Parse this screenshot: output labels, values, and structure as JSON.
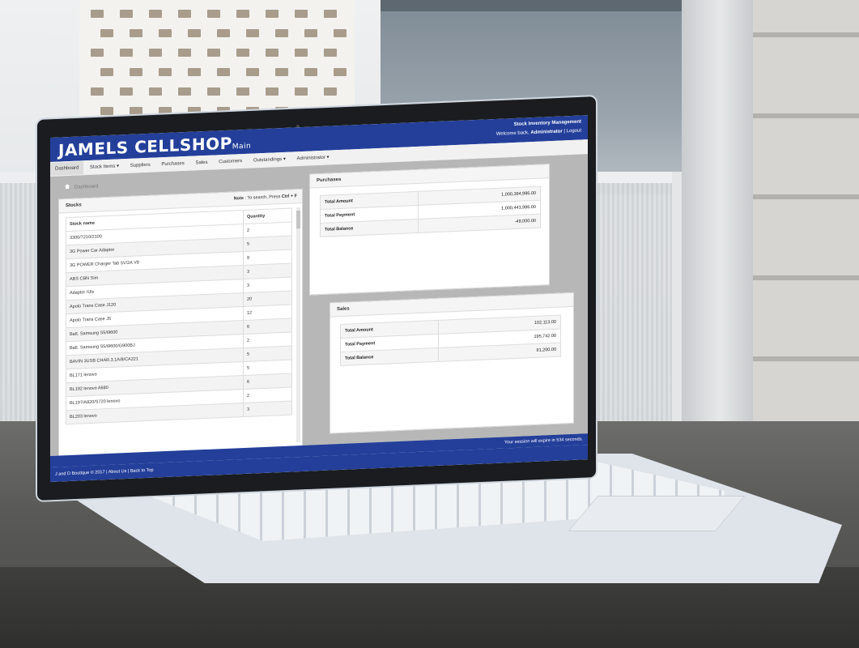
{
  "app": {
    "brand": "JAMELS CELLSHOP",
    "brand_sub": "Main",
    "system_title": "Stock Inventory Management",
    "welcome_prefix": "Welcome back,",
    "user": "Administrator",
    "logout": "Logout"
  },
  "nav": [
    {
      "label": "Dashboard"
    },
    {
      "label": "Stock Items ▾"
    },
    {
      "label": "Suppliers"
    },
    {
      "label": "Purchases"
    },
    {
      "label": "Sales"
    },
    {
      "label": "Customers"
    },
    {
      "label": "Outstandings ▾"
    },
    {
      "label": "Administrator ▾"
    }
  ],
  "breadcrumb": "Dashboard",
  "stocks": {
    "title": "Stocks",
    "note_label": "Note",
    "note_text": ": To search, Press",
    "note_keys": "Ctrl + F",
    "col_name": "Stock name",
    "col_qty": "Quantity",
    "rows": [
      {
        "name": "3300/7210/2100",
        "qty": "2"
      },
      {
        "name": "3G Power Car Adaptor",
        "qty": "5"
      },
      {
        "name": "3G POWER Charger Tab 5V/2A V8",
        "qty": "9"
      },
      {
        "name": "ABS CBN Sim",
        "qty": "3"
      },
      {
        "name": "Adaptor /Uls",
        "qty": "3"
      },
      {
        "name": "Apolo Trans Case J120",
        "qty": "20"
      },
      {
        "name": "Apolo Trans Case J5",
        "qty": "12"
      },
      {
        "name": "Batt. Samsung S5/i9600",
        "qty": "6"
      },
      {
        "name": "Batt. Samsung S5/i9600/G900BJ",
        "qty": "2"
      },
      {
        "name": "BAVIN 3USB CHAR.3.1A/8/CA221",
        "qty": "5"
      },
      {
        "name": "BL171 lenovo",
        "qty": "5"
      },
      {
        "name": "BL192 lenovo A680",
        "qty": "6"
      },
      {
        "name": "BL197/A820/S720 lenovo",
        "qty": "2"
      },
      {
        "name": "BL203 lenovo",
        "qty": "3"
      }
    ]
  },
  "purchases": {
    "title": "Purchases",
    "rows": [
      {
        "label": "Total Amount",
        "value": "1,000,394,986.00"
      },
      {
        "label": "Total Payment",
        "value": "1,000,443,986.00"
      },
      {
        "label": "Total Balance",
        "value": "-49,000.00"
      }
    ]
  },
  "sales": {
    "title": "Sales",
    "rows": [
      {
        "label": "Total Amount",
        "value": "102,113.00"
      },
      {
        "label": "Total Payment",
        "value": "195,742.00"
      },
      {
        "label": "Total Balance",
        "value": "91,200.00"
      }
    ]
  },
  "session_text": "Your session will expire in 534 seconds.",
  "footer": {
    "copyright": "J and D Boutique © 2017",
    "about": "About Us",
    "top": "Back to Top"
  },
  "colors": {
    "header_blue": "#233f9a",
    "content_gray": "#b7b7b7"
  }
}
